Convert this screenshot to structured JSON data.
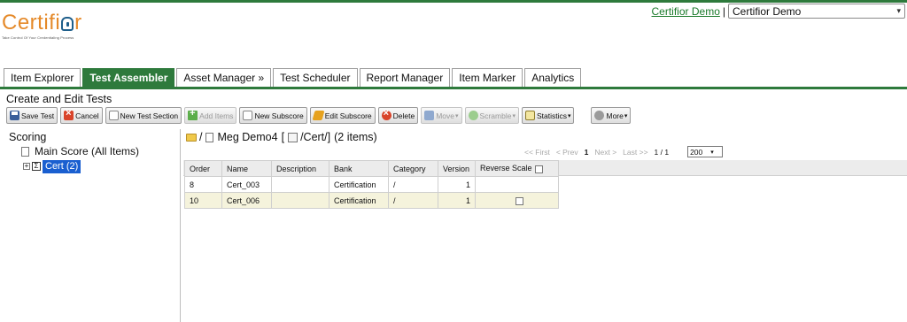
{
  "header": {
    "logo_text_pre": "Certifi",
    "logo_text_post": "r",
    "logo_tagline": "Take Control Of Your Credentialing Process",
    "user_link": "Certifior Demo",
    "separator": "|",
    "org_select_value": "Certifior Demo"
  },
  "tabs": [
    {
      "label": "Item Explorer",
      "active": false
    },
    {
      "label": "Test Assembler",
      "active": true
    },
    {
      "label": "Asset Manager »",
      "active": false
    },
    {
      "label": "Test Scheduler",
      "active": false
    },
    {
      "label": "Report Manager",
      "active": false
    },
    {
      "label": "Item Marker",
      "active": false
    },
    {
      "label": "Analytics",
      "active": false
    }
  ],
  "section_title": "Create and Edit Tests",
  "toolbar": {
    "save_test": "Save Test",
    "cancel": "Cancel",
    "new_test_section": "New Test Section",
    "add_items": "Add Items",
    "new_subscore": "New Subscore",
    "edit_subscore": "Edit Subscore",
    "delete": "Delete",
    "move": "Move",
    "scramble": "Scramble",
    "statistics": "Statistics",
    "more": "More"
  },
  "scoring": {
    "title": "Scoring",
    "main_score": "Main Score (All Items)",
    "expander": "+",
    "sigma": "Σ",
    "cert_node": "Cert (2)"
  },
  "path": {
    "sep1": "/",
    "test_name": "Meg Demo4",
    "folder": "/Cert/]",
    "open_bracket": "[",
    "count": "(2 items)"
  },
  "pager": {
    "first": "<< First",
    "prev": "< Prev",
    "current": "1",
    "next": "Next >",
    "last": "Last >>",
    "of": "1 / 1",
    "page_size": "200"
  },
  "grid": {
    "headers": {
      "order": "Order",
      "name": "Name",
      "description": "Description",
      "bank": "Bank",
      "category": "Category",
      "version": "Version",
      "reverse_scale": "Reverse Scale"
    },
    "rows": [
      {
        "order": "8",
        "name": "Cert_003",
        "description": "",
        "bank": "Certification",
        "category": "/",
        "version": "1",
        "reverse_scale": false
      },
      {
        "order": "10",
        "name": "Cert_006",
        "description": "",
        "bank": "Certification",
        "category": "/",
        "version": "1",
        "reverse_scale": false
      }
    ]
  },
  "colors": {
    "brand_green": "#2e7a3c",
    "logo_orange": "#e58a2a",
    "selection_blue": "#1a5fd0",
    "row_alt": "#f5f3dc"
  }
}
